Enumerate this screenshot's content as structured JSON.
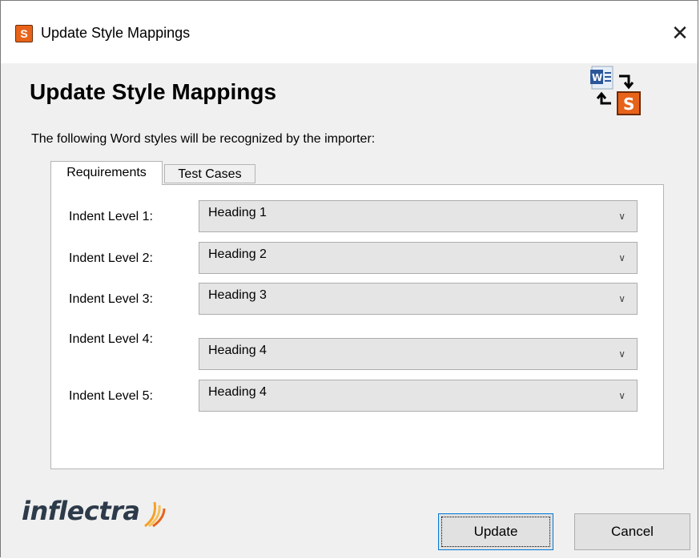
{
  "window": {
    "title": "Update Style Mappings",
    "icons": {
      "app": "spira-icon",
      "close": "close-icon"
    }
  },
  "header": {
    "title": "Update Style Mappings",
    "description": "The following Word styles will be recognized by the importer:",
    "hero_icon": "word-to-spira-sync-icon"
  },
  "tabs": [
    {
      "label": "Requirements",
      "active": true
    },
    {
      "label": "Test Cases",
      "active": false
    }
  ],
  "mappings": [
    {
      "label": "Indent Level 1:",
      "value": "Heading 1"
    },
    {
      "label": "Indent Level 2:",
      "value": "Heading 2"
    },
    {
      "label": "Indent Level 3:",
      "value": "Heading 3"
    },
    {
      "label": "Indent Level 4:",
      "value": "Heading 4"
    },
    {
      "label": "Indent Level 5:",
      "value": "Heading 4"
    }
  ],
  "footer": {
    "brand": "inflectra",
    "update_label": "Update",
    "cancel_label": "Cancel"
  },
  "colors": {
    "accent": "#e8631a",
    "focus": "#0078d7",
    "brand_text": "#2d3a4a"
  }
}
